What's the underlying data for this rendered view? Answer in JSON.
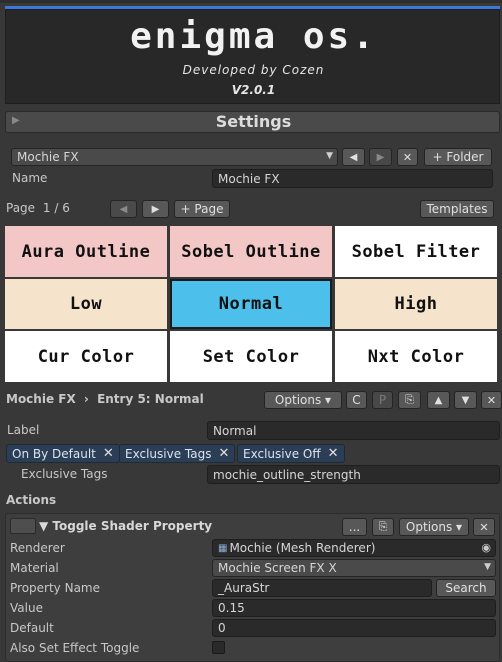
{
  "header": {
    "title": "enigma os.",
    "developer": "Developed by Cozen",
    "version": "V2.0.1"
  },
  "settings_bar": {
    "label": "Settings"
  },
  "preset": {
    "selected": "Mochie FX",
    "folder_button": "+ Folder",
    "close_glyph": "✕",
    "name_label": "Name",
    "name_value": "Mochie FX"
  },
  "pager": {
    "label": "Page",
    "current": "1 / 6",
    "add_page": "+ Page",
    "templates": "Templates"
  },
  "grid": {
    "cells": [
      {
        "label": "Aura Outline",
        "color": "#f4c7c7"
      },
      {
        "label": "Sobel Outline",
        "color": "#f4c7c7"
      },
      {
        "label": "Sobel Filter",
        "color": "#ffffff"
      },
      {
        "label": "Low",
        "color": "#f5e3cc"
      },
      {
        "label": "Normal",
        "color": "#4cbfea"
      },
      {
        "label": "High",
        "color": "#f5e3cc"
      },
      {
        "label": "Cur Color",
        "color": "#ffffff"
      },
      {
        "label": "Set Color",
        "color": "#ffffff"
      },
      {
        "label": "Nxt Color",
        "color": "#ffffff"
      }
    ]
  },
  "entry": {
    "crumb_root": "Mochie FX",
    "crumb_sep": "›",
    "crumb_entry": "Entry 5: Normal",
    "options_button": "Options ▾",
    "c_button": "C",
    "p_button": "P",
    "label_label": "Label",
    "label_value": "Normal",
    "tags": [
      "On By Default",
      "Exclusive Tags",
      "Exclusive Off"
    ],
    "tag_close": "✕",
    "exclusive_tags_label": "Exclusive Tags",
    "exclusive_tags_value": "mochie_outline_strength"
  },
  "actions": {
    "title": "Actions",
    "action_title": "▼ Toggle Shader Property",
    "ellipsis": "...",
    "options_button": "Options ▾",
    "close_glyph": "✕",
    "renderer_label": "Renderer",
    "renderer_value": "Mochie (Mesh Renderer)",
    "material_label": "Material",
    "material_value": "Mochie Screen FX X",
    "property_label": "Property Name",
    "property_value": "_AuraStr",
    "search_button": "Search",
    "value_label": "Value",
    "value_value": "0.15",
    "default_label": "Default",
    "default_value": "0",
    "also_set_label": "Also Set Effect Toggle",
    "also_set_checked": false
  },
  "colors": {
    "accent": "#3c78d8",
    "selected_cell": "#4cbfea",
    "tag_bg": "#2b3e55"
  }
}
